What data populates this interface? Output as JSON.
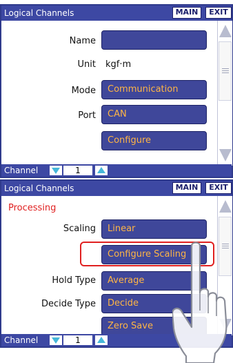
{
  "top_panel": {
    "title": "Logical Channels",
    "main_label": "MAIN",
    "exit_label": "EXIT",
    "name": {
      "label": "Name",
      "value": ""
    },
    "unit": {
      "label": "Unit",
      "value": "kgf·m"
    },
    "mode": {
      "label": "Mode",
      "value": "Communication"
    },
    "port": {
      "label": "Port",
      "value": "CAN"
    },
    "configure": {
      "value": "Configure"
    },
    "channel_label": "Channel",
    "channel_value": "1"
  },
  "bottom_panel": {
    "title": "Logical Channels",
    "main_label": "MAIN",
    "exit_label": "EXIT",
    "section": "Processing",
    "scaling": {
      "label": "Scaling",
      "value": "Linear"
    },
    "configure_scaling": {
      "value": "Configure Scaling"
    },
    "hold_type": {
      "label": "Hold Type",
      "value": "Average"
    },
    "decide_type": {
      "label": "Decide Type",
      "value": "Decide"
    },
    "zero_save": {
      "value": "Zero Save"
    },
    "channel_label": "Channel",
    "channel_value": "1"
  },
  "icons": [
    "scroll-up-icon",
    "scroll-down-icon",
    "channel-down-icon",
    "channel-up-icon",
    "hand-pointer-icon"
  ],
  "colors": {
    "title_bar": "#3d48a3",
    "button_fill": "#3f479a",
    "button_text": "#ffb545",
    "highlight": "#e02020",
    "arrow": "#47b7d9"
  }
}
